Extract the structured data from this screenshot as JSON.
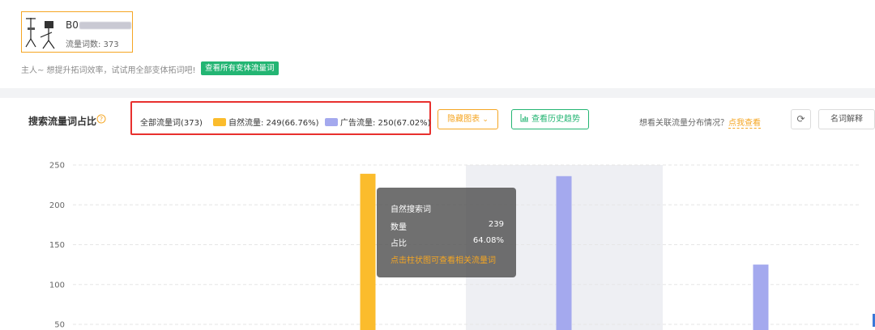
{
  "product": {
    "asin": "B0",
    "word_count": "流量词数: 373"
  },
  "tip": {
    "text": "主人~ 想提升拓词效率，试试用全部变体拓词吧!",
    "button": "查看所有变体流量词"
  },
  "toolbar": {
    "title": "搜索流量词占比",
    "legend_all": "全部流量词(373)",
    "legend_natural": "自然流量: 249(66.76%)",
    "legend_ad": "广告流量: 250(67.02%)",
    "hide_chart": "隐藏图表",
    "history_trend": "查看历史趋势",
    "relate_question": "想看关联流量分布情况？",
    "relate_link": "点我查看",
    "glossary": "名词解释"
  },
  "chart_data": {
    "type": "bar",
    "categories": [
      "",
      "",
      "",
      "",
      ""
    ],
    "series": [
      {
        "name": "自然流量",
        "color": "#fbbc2c",
        "values": [
          null,
          239,
          null,
          null,
          null
        ]
      },
      {
        "name": "广告流量",
        "color": "#a4a9ee",
        "values": [
          null,
          null,
          236,
          125,
          null
        ]
      }
    ],
    "yticks": [
      "250",
      "200",
      "150",
      "100",
      "50"
    ],
    "ylim": [
      0,
      250
    ],
    "grid": true,
    "highlight_category": 1
  },
  "tooltip": {
    "title": "自然搜索词",
    "count_label": "数量",
    "count_value": "239",
    "ratio_label": "占比",
    "ratio_value": "64.08%",
    "hint": "点击柱状图可查看相关流量词"
  },
  "colors": {
    "orange": "#f5a623",
    "green": "#23b573",
    "red_frame": "#e8302e",
    "natural": "#fbbc2c",
    "ad": "#a4a9ee"
  }
}
